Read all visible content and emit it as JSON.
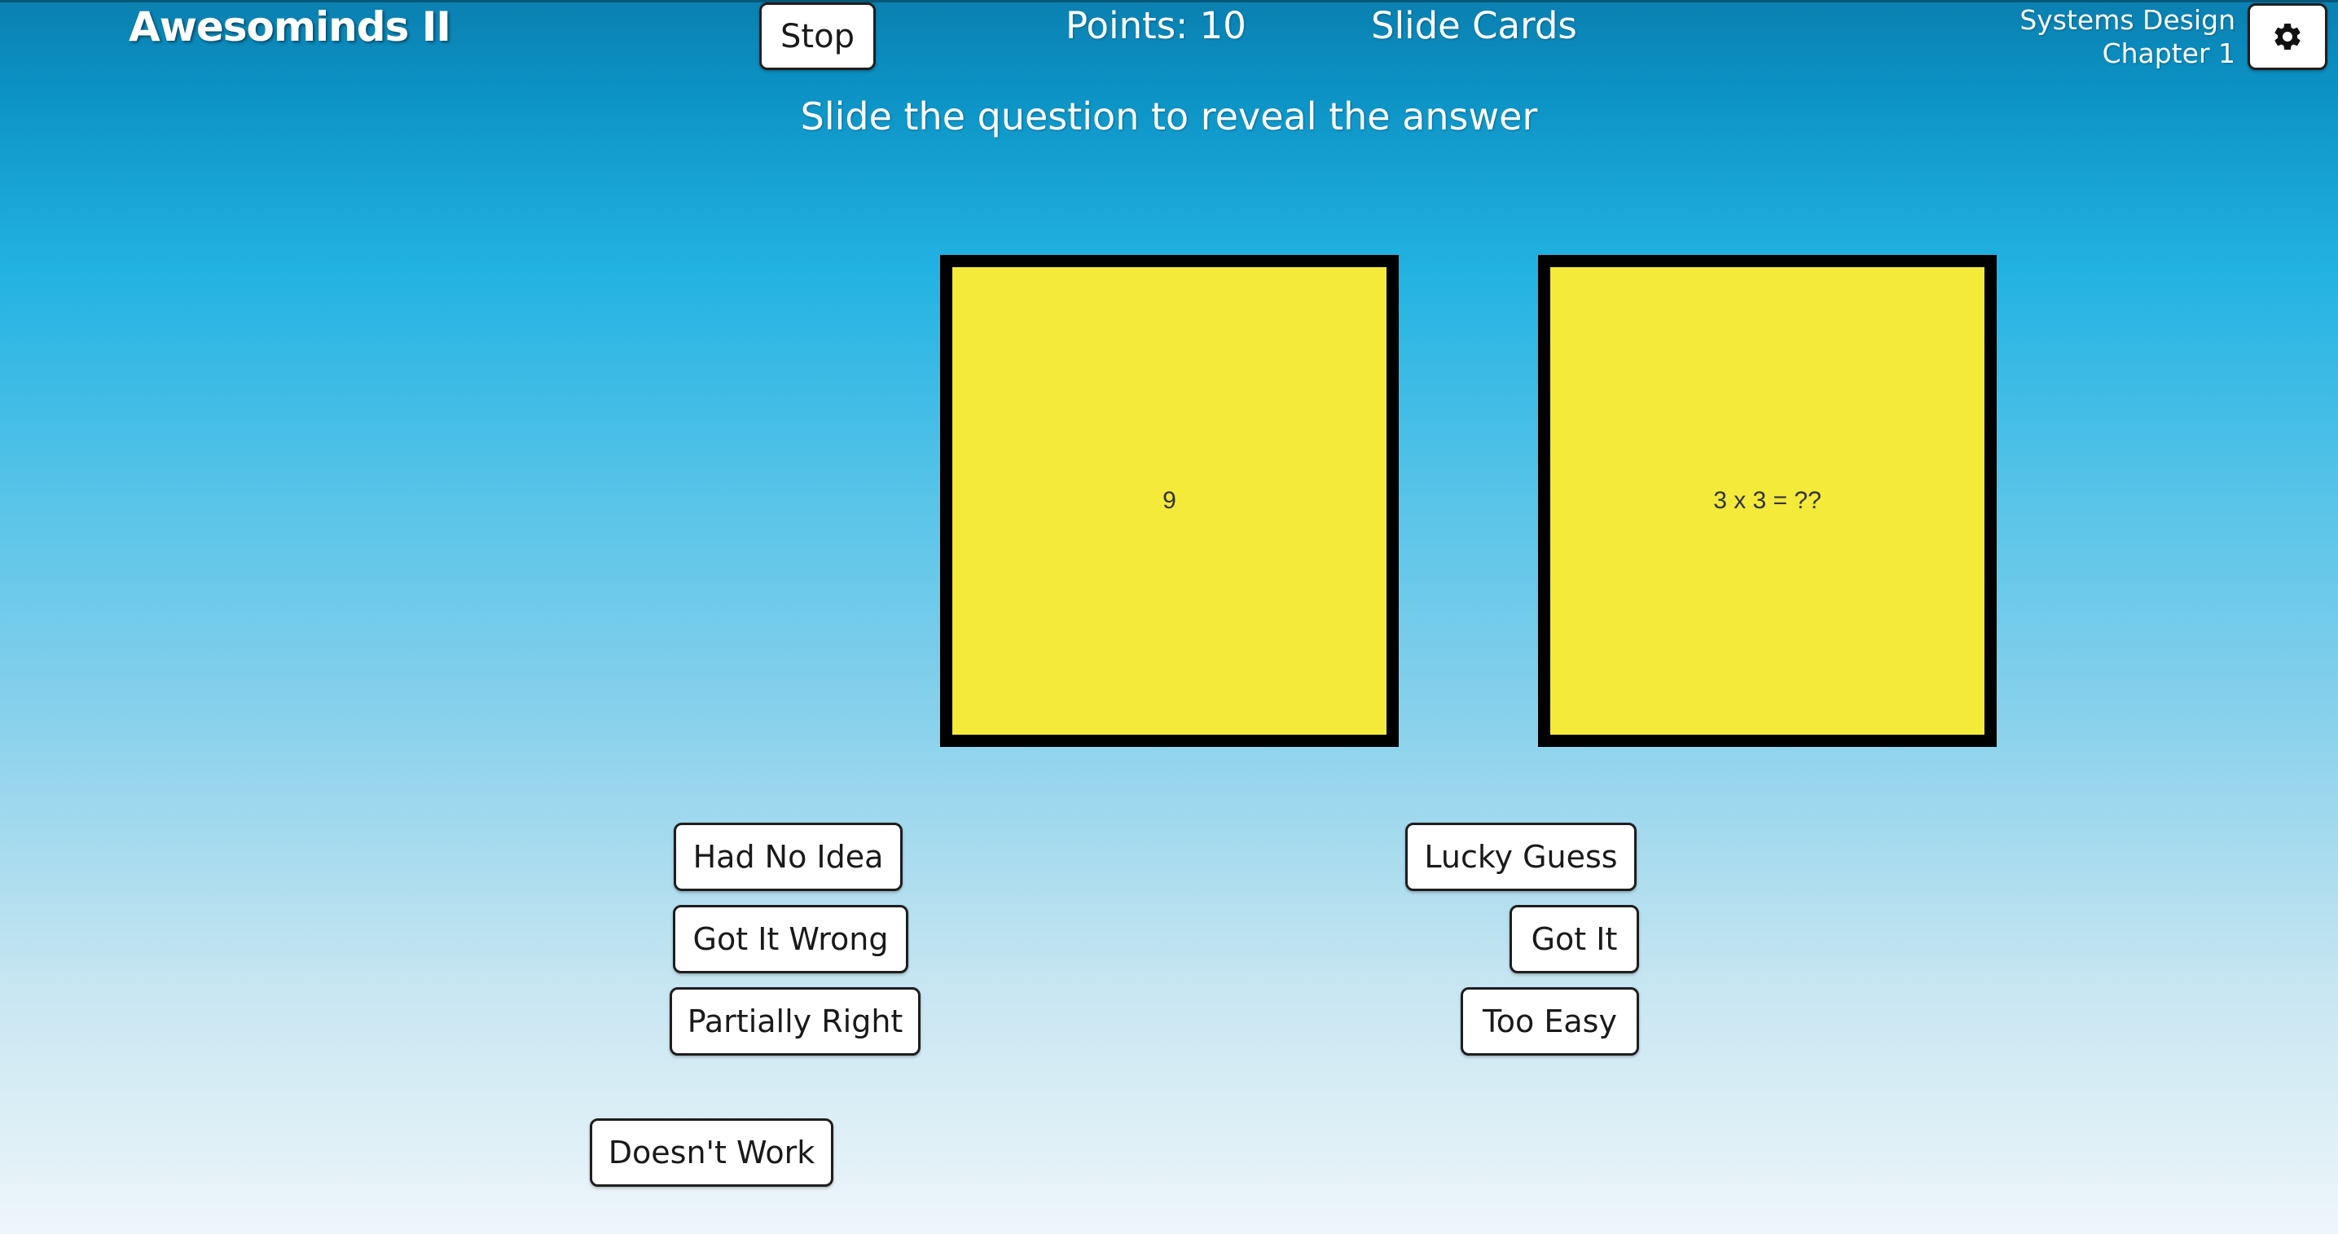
{
  "header": {
    "app_title": "Awesominds II",
    "stop_label": "Stop",
    "points_label": "Points:",
    "points_value": "10",
    "mode_title": "Slide Cards",
    "subject_line1": "Systems Design",
    "subject_line2": "Chapter 1",
    "settings_icon": "gear-icon"
  },
  "instruction": "Slide the question to reveal the answer",
  "cards": {
    "answer": "9",
    "question": "3 x 3 = ??"
  },
  "ratings": {
    "had_no_idea": "Had No Idea",
    "got_it_wrong": "Got It Wrong",
    "partially_right": "Partially Right",
    "lucky_guess": "Lucky Guess",
    "got_it": "Got It",
    "too_easy": "Too Easy",
    "doesnt_work": "Doesn't Work"
  },
  "colors": {
    "card_fill": "#f3ea3a",
    "card_border": "#000000",
    "background_top": "#0a80b0",
    "background_bottom": "#eef6fa"
  }
}
